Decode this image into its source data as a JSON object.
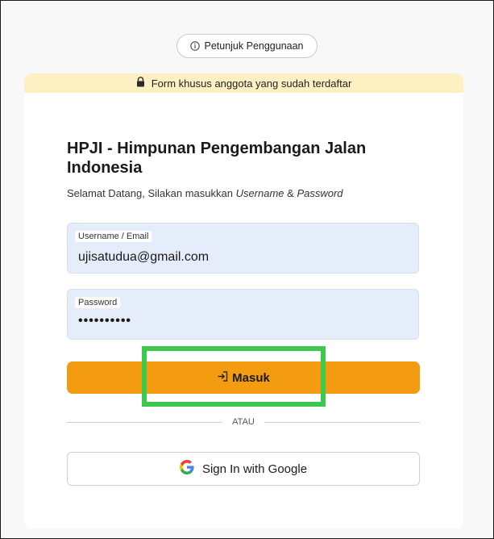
{
  "help_button": {
    "label": "Petunjuk Penggunaan",
    "icon": "info-icon"
  },
  "notice": {
    "text": "Form khusus anggota yang sudah terdaftar",
    "icon": "lock-icon",
    "background": "#fdf0c2"
  },
  "form": {
    "title": "HPJI - Himpunan Pengembangan Jalan Indonesia",
    "subtitle_prefix": "Selamat Datang, Silakan masukkan ",
    "subtitle_username": "Username",
    "subtitle_amp": " & ",
    "subtitle_password": "Password",
    "username": {
      "label": "Username / Email",
      "value": "ujisatudua@gmail.com"
    },
    "password": {
      "label": "Password",
      "value": "••••••••••"
    },
    "login_button": {
      "label": "Masuk",
      "icon": "login-icon",
      "color": "#f39c12"
    },
    "divider_text": "ATAU",
    "google_button": {
      "label": "Sign In with Google",
      "icon": "google-icon"
    }
  },
  "highlight_color": "#3cc94e"
}
